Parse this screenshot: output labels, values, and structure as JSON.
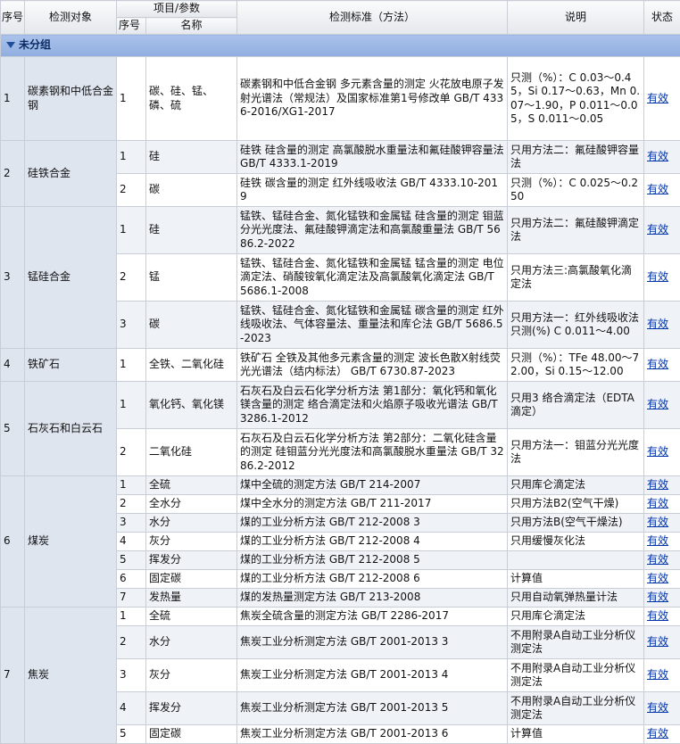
{
  "header": {
    "seq": "序号",
    "target": "检测对象",
    "item_param": "项目/参数",
    "item_seq": "序号",
    "item_name": "名称",
    "standard": "检测标准（方法）",
    "note": "说明",
    "status": "状态"
  },
  "group": {
    "label": "未分组"
  },
  "objects": [
    {
      "seq": "1",
      "name": "碳素钢和中低合金钢",
      "items": [
        {
          "seq": "1",
          "name": "碳、硅、锰、磷、硫",
          "standard": "碳素钢和中低合金钢 多元素含量的测定 火花放电原子发射光谱法（常规法）及国家标准第1号修改单 GB/T 4336-2016/XG1-2017",
          "note": "只测（%）：C 0.03～0.45，Si 0.17～0.63，Mn 0.07～1.90，P 0.011～0.05，S 0.011～0.05",
          "status": "有效"
        }
      ]
    },
    {
      "seq": "2",
      "name": "硅铁合金",
      "items": [
        {
          "seq": "1",
          "name": "硅",
          "standard": "硅铁 硅含量的测定 高氯酸脱水重量法和氟硅酸钾容量法 GB/T 4333.1-2019",
          "note": "只用方法二：氟硅酸钾容量法",
          "status": "有效"
        },
        {
          "seq": "2",
          "name": "碳",
          "standard": "硅铁 碳含量的测定 红外线吸收法 GB/T 4333.10-2019",
          "note": "只测（%）：C 0.025～0.250",
          "status": "有效"
        }
      ]
    },
    {
      "seq": "3",
      "name": "锰硅合金",
      "items": [
        {
          "seq": "1",
          "name": "硅",
          "standard": "锰铁、锰硅合金、氮化锰铁和金属锰 硅含量的测定 钼蓝分光光度法、氟硅酸钾滴定法和高氯酸重量法 GB/T 5686.2-2022",
          "note": "只用方法二：氟硅酸钾滴定法",
          "status": "有效"
        },
        {
          "seq": "2",
          "name": "锰",
          "standard": "锰铁、锰硅合金、氮化锰铁和金属锰 锰含量的测定 电位滴定法、硝酸铵氧化滴定法及高氯酸氧化滴定法 GB/T 5686.1-2008",
          "note": "只用方法三:高氯酸氧化滴定法",
          "status": "有效"
        },
        {
          "seq": "3",
          "name": "碳",
          "standard": "锰铁、锰硅合金、氮化锰铁和金属锰 碳含量的测定 红外线吸收法、气体容量法、重量法和库仑法 GB/T 5686.5-2023",
          "note": "只用方法一：红外线吸收法只测(%) C 0.011～4.00",
          "status": "有效"
        }
      ]
    },
    {
      "seq": "4",
      "name": "铁矿石",
      "items": [
        {
          "seq": "1",
          "name": "全铁、二氧化硅",
          "standard": "铁矿石 全铁及其他多元素含量的测定 波长色散X射线荧光光谱法（结内标法） GB/T 6730.87-2023",
          "note": "只测（%）：TFe 48.00～72.00，Si 0.15～12.00",
          "status": "有效"
        }
      ]
    },
    {
      "seq": "5",
      "name": "石灰石和白云石",
      "items": [
        {
          "seq": "1",
          "name": "氧化钙、氧化镁",
          "standard": "石灰石及白云石化学分析方法 第1部分：氧化钙和氧化镁含量的测定 络合滴定法和火焰原子吸收光谱法 GB/T 3286.1-2012",
          "note": "只用3 络合滴定法（EDTA滴定）",
          "status": "有效"
        },
        {
          "seq": "2",
          "name": "二氧化硅",
          "standard": "石灰石及白云石化学分析方法 第2部分：二氧化硅含量的测定 硅钼蓝分光光度法和高氯酸脱水重量法 GB/T 3286.2-2012",
          "note": "只用方法一：钼蓝分光光度法",
          "status": "有效"
        }
      ]
    },
    {
      "seq": "6",
      "name": "煤炭",
      "items": [
        {
          "seq": "1",
          "name": "全硫",
          "standard": "煤中全硫的测定方法 GB/T 214-2007",
          "note": "只用库仑滴定法",
          "status": "有效"
        },
        {
          "seq": "2",
          "name": "全水分",
          "standard": "煤中全水分的测定方法 GB/T 211-2017",
          "note": "只用方法B2(空气干燥)",
          "status": "有效"
        },
        {
          "seq": "3",
          "name": "水分",
          "standard": "煤的工业分析方法 GB/T 212-2008 3",
          "note": "只用方法B(空气干燥法)",
          "status": "有效"
        },
        {
          "seq": "4",
          "name": "灰分",
          "standard": "煤的工业分析方法 GB/T 212-2008 4",
          "note": "只用缓慢灰化法",
          "status": "有效"
        },
        {
          "seq": "5",
          "name": "挥发分",
          "standard": "煤的工业分析方法 GB/T 212-2008 5",
          "note": "",
          "status": "有效"
        },
        {
          "seq": "6",
          "name": "固定碳",
          "standard": "煤的工业分析方法 GB/T 212-2008 6",
          "note": "计算值",
          "status": "有效"
        },
        {
          "seq": "7",
          "name": "发热量",
          "standard": "煤的发热量测定方法 GB/T 213-2008",
          "note": "只用自动氧弹热量计法",
          "status": "有效"
        }
      ]
    },
    {
      "seq": "7",
      "name": "焦炭",
      "items": [
        {
          "seq": "1",
          "name": "全硫",
          "standard": "焦炭全硫含量的测定方法 GB/T 2286-2017",
          "note": "只用库仑滴定法",
          "status": "有效"
        },
        {
          "seq": "2",
          "name": "水分",
          "standard": "焦炭工业分析测定方法 GB/T 2001-2013 3",
          "note": "不用附录A自动工业分析仪测定法",
          "status": "有效"
        },
        {
          "seq": "3",
          "name": "灰分",
          "standard": "焦炭工业分析测定方法 GB/T 2001-2013 4",
          "note": "不用附录A自动工业分析仪测定法",
          "status": "有效"
        },
        {
          "seq": "4",
          "name": "挥发分",
          "standard": "焦炭工业分析测定方法 GB/T 2001-2013 5",
          "note": "不用附录A自动工业分析仪测定法",
          "status": "有效"
        },
        {
          "seq": "5",
          "name": "固定碳",
          "standard": "焦炭工业分析测定方法 GB/T 2001-2013 6",
          "note": "计算值",
          "status": "有效"
        }
      ]
    }
  ]
}
